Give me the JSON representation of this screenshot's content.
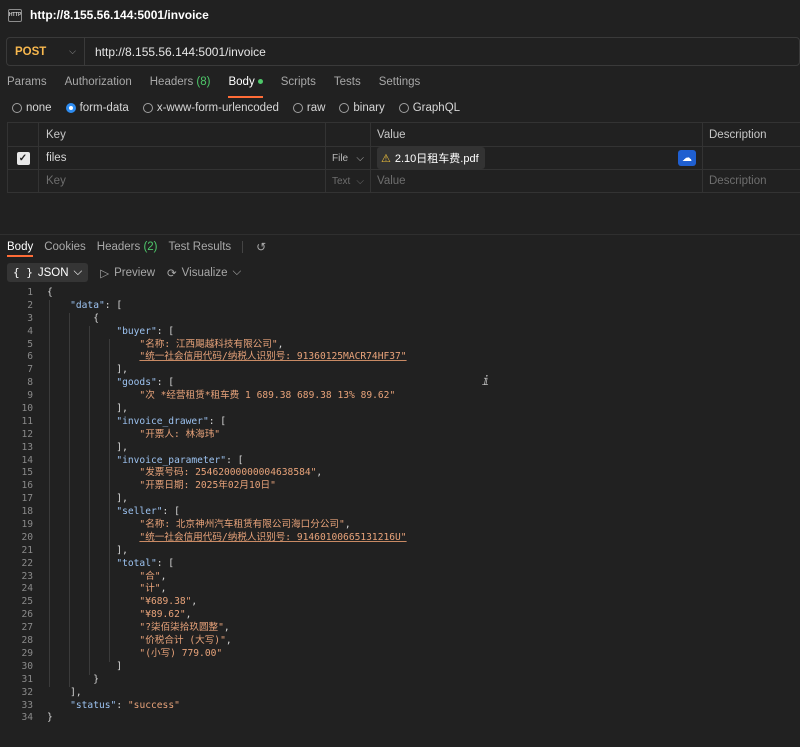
{
  "window": {
    "tab_title": "http://8.155.56.144:5001/invoice",
    "tab_icon": "HTTP"
  },
  "request": {
    "method": "POST",
    "url": "http://8.155.56.144:5001/invoice",
    "tabs": [
      {
        "label": "Params"
      },
      {
        "label": "Authorization"
      },
      {
        "label": "Headers",
        "count": "(8)"
      },
      {
        "label": "Body",
        "active": true
      },
      {
        "label": "Scripts"
      },
      {
        "label": "Tests"
      },
      {
        "label": "Settings"
      }
    ],
    "body_types": [
      "none",
      "form-data",
      "x-www-form-urlencoded",
      "raw",
      "binary",
      "GraphQL"
    ],
    "body_type_selected": "form-data",
    "table": {
      "headers": [
        "Key",
        "Value",
        "Description"
      ],
      "rows": [
        {
          "key": "files",
          "type": "File",
          "value": "2.10日租车费.pdf",
          "description": ""
        }
      ],
      "empty_row": {
        "key_placeholder": "Key",
        "type": "Text",
        "value_placeholder": "Value",
        "description_placeholder": "Description"
      }
    }
  },
  "response": {
    "tabs": [
      {
        "label": "Body",
        "active": true
      },
      {
        "label": "Cookies"
      },
      {
        "label": "Headers",
        "count": "(2)"
      },
      {
        "label": "Test Results"
      }
    ],
    "view": {
      "format": "JSON",
      "preview": "Preview",
      "visualize": "Visualize"
    },
    "lines": [
      [
        [
          "p",
          "{"
        ]
      ],
      [
        [
          "p",
          "    "
        ],
        [
          "k",
          "\"data\""
        ],
        [
          "p",
          ": ["
        ]
      ],
      [
        [
          "p",
          "        {"
        ]
      ],
      [
        [
          "p",
          "            "
        ],
        [
          "k",
          "\"buyer\""
        ],
        [
          "p",
          ": ["
        ]
      ],
      [
        [
          "p",
          "                "
        ],
        [
          "s",
          "\"名称: 江西飓越科技有限公司\""
        ],
        [
          "p",
          ","
        ]
      ],
      [
        [
          "p",
          "                "
        ],
        [
          "su",
          "\"统一社会信用代码/纳税人识别号: 91360125MACR74HF37\""
        ]
      ],
      [
        [
          "p",
          "            ],"
        ]
      ],
      [
        [
          "p",
          "            "
        ],
        [
          "k",
          "\"goods\""
        ],
        [
          "p",
          ": ["
        ]
      ],
      [
        [
          "p",
          "                "
        ],
        [
          "s",
          "\"次 *经营租赁*租车费 1 689.38 689.38 13% 89.62\""
        ]
      ],
      [
        [
          "p",
          "            ],"
        ]
      ],
      [
        [
          "p",
          "            "
        ],
        [
          "k",
          "\"invoice_drawer\""
        ],
        [
          "p",
          ": ["
        ]
      ],
      [
        [
          "p",
          "                "
        ],
        [
          "s",
          "\"开票人: 林海玮\""
        ]
      ],
      [
        [
          "p",
          "            ],"
        ]
      ],
      [
        [
          "p",
          "            "
        ],
        [
          "k",
          "\"invoice_parameter\""
        ],
        [
          "p",
          ": ["
        ]
      ],
      [
        [
          "p",
          "                "
        ],
        [
          "s",
          "\"发票号码: 25462000000004638584\""
        ],
        [
          "p",
          ","
        ]
      ],
      [
        [
          "p",
          "                "
        ],
        [
          "s",
          "\"开票日期: 2025年02月10日\""
        ]
      ],
      [
        [
          "p",
          "            ],"
        ]
      ],
      [
        [
          "p",
          "            "
        ],
        [
          "k",
          "\"seller\""
        ],
        [
          "p",
          ": ["
        ]
      ],
      [
        [
          "p",
          "                "
        ],
        [
          "s",
          "\"名称: 北京神州汽车租赁有限公司海口分公司\""
        ],
        [
          "p",
          ","
        ]
      ],
      [
        [
          "p",
          "                "
        ],
        [
          "su",
          "\"统一社会信用代码/纳税人识别号: 91460100665131216U\""
        ]
      ],
      [
        [
          "p",
          "            ],"
        ]
      ],
      [
        [
          "p",
          "            "
        ],
        [
          "k",
          "\"total\""
        ],
        [
          "p",
          ": ["
        ]
      ],
      [
        [
          "p",
          "                "
        ],
        [
          "s",
          "\"合\""
        ],
        [
          "p",
          ","
        ]
      ],
      [
        [
          "p",
          "                "
        ],
        [
          "s",
          "\"计\""
        ],
        [
          "p",
          ","
        ]
      ],
      [
        [
          "p",
          "                "
        ],
        [
          "s",
          "\"¥689.38\""
        ],
        [
          "p",
          ","
        ]
      ],
      [
        [
          "p",
          "                "
        ],
        [
          "s",
          "\"¥89.62\""
        ],
        [
          "p",
          ","
        ]
      ],
      [
        [
          "p",
          "                "
        ],
        [
          "s",
          "\"?柒佰柒拾玖圆整\""
        ],
        [
          "p",
          ","
        ]
      ],
      [
        [
          "p",
          "                "
        ],
        [
          "s",
          "\"价税合计 (大写)\""
        ],
        [
          "p",
          ","
        ]
      ],
      [
        [
          "p",
          "                "
        ],
        [
          "s",
          "\"(小写) 779.00\""
        ]
      ],
      [
        [
          "p",
          "            ]"
        ]
      ],
      [
        [
          "p",
          "        }"
        ]
      ],
      [
        [
          "p",
          "    ],"
        ]
      ],
      [
        [
          "p",
          "    "
        ],
        [
          "k",
          "\"status\""
        ],
        [
          "p",
          ": "
        ],
        [
          "s",
          "\"success\""
        ]
      ],
      [
        [
          "p",
          "}"
        ]
      ]
    ]
  },
  "colors": {
    "accent": "#ff6c37",
    "method": "#f8b84e",
    "json_key": "#9cc2f0",
    "json_string": "#e8a37a",
    "count": "#4ec86a"
  }
}
